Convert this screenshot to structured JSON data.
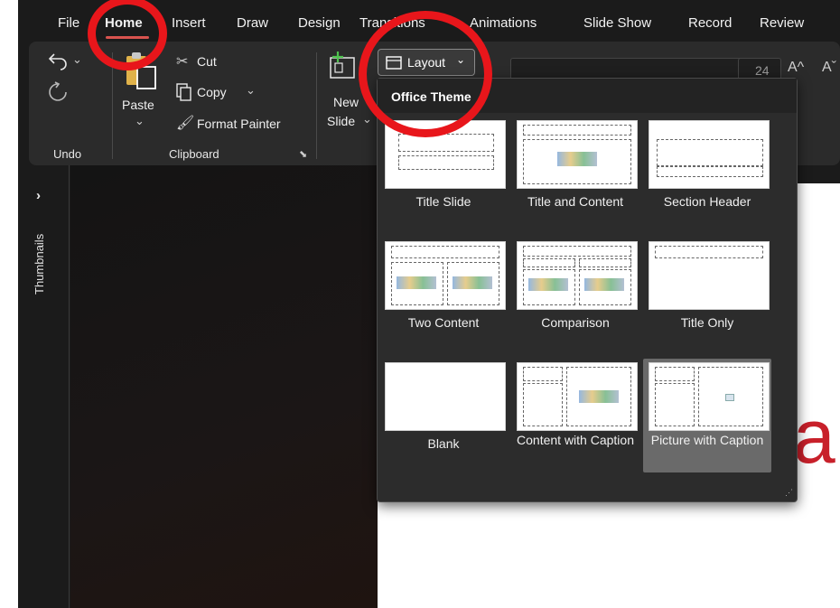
{
  "tabs": [
    "File",
    "Home",
    "Insert",
    "Draw",
    "Design",
    "Transitions",
    "Animations",
    "Slide Show",
    "Record",
    "Review"
  ],
  "active_tab": "Home",
  "ribbon": {
    "undo_label": "Undo",
    "paste_label": "Paste",
    "cut_label": "Cut",
    "copy_label": "Copy",
    "format_painter_label": "Format Painter",
    "clipboard_label": "Clipboard",
    "new_slide_label_1": "New",
    "new_slide_label_2": "Slide",
    "layout_button": "Layout",
    "font_size": "24",
    "grow_font": "A^",
    "shrink_font": "Aˇ"
  },
  "left_panel": {
    "thumbnails_label": "Thumbnails"
  },
  "dropdown": {
    "title": "Office Theme",
    "layouts": [
      {
        "label": "Title Slide"
      },
      {
        "label": "Title and Content"
      },
      {
        "label": "Section Header"
      },
      {
        "label": "Two Content"
      },
      {
        "label": "Comparison"
      },
      {
        "label": "Title Only"
      },
      {
        "label": "Blank"
      },
      {
        "label": "Content with Caption"
      },
      {
        "label": "Picture with Caption"
      }
    ],
    "selected": "Picture with Caption"
  },
  "slide": {
    "visible_text": "a"
  },
  "colors": {
    "app_bg": "#1b1b1b",
    "ribbon_bg": "#2b2b2b",
    "accent_underline": "#d9534f",
    "annotation_red": "#e8161b",
    "selected_tile": "#6a6a6a",
    "slide_text": "#c8202a"
  }
}
